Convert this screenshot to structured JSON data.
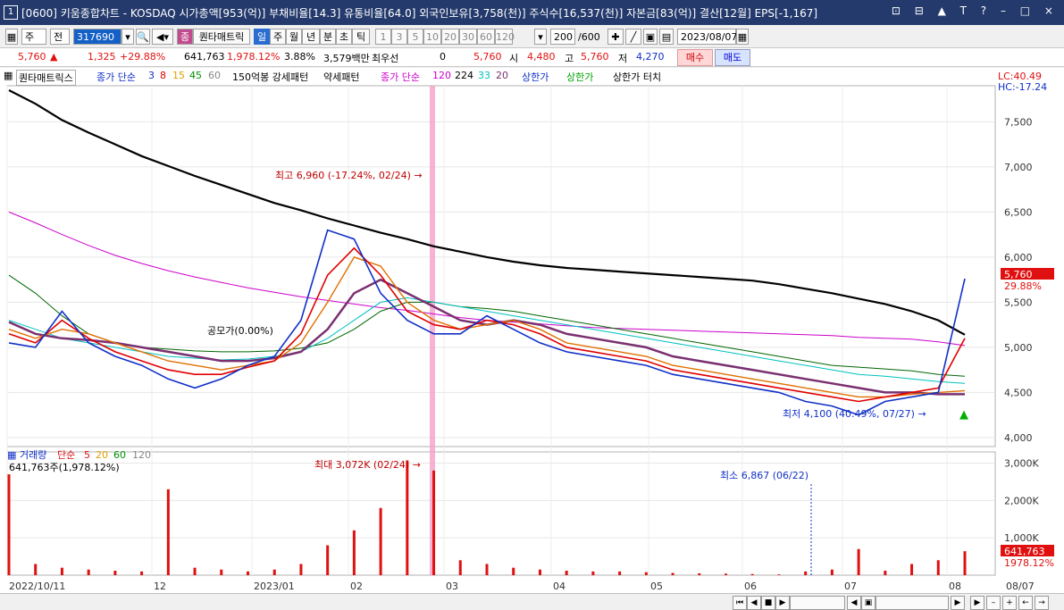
{
  "title": {
    "text": "[0600] 키움종합차트 - KOSDAQ 시가총액[953(억)] 부채비율[14.3] 유통비율[64.0] 외국인보유[3,758(천)] 주식수[16,537(천)] 자본금[83(억)] 결산[12월] EPS[-1,167]",
    "num": "1",
    "buttons": "⊡ ⊟ ▲ T ?   –  □  ×"
  },
  "toolbar": {
    "market": "주",
    "mode": "전",
    "code": "317690",
    "quantamatrix": "퀀타매트릭",
    "jong": "종",
    "periods": [
      "일",
      "주",
      "월",
      "년",
      "분",
      "초",
      "틱"
    ],
    "period_selected": "일",
    "numbers": [
      "1",
      "3",
      "5",
      "10",
      "20",
      "30",
      "60",
      "120"
    ],
    "count": "200",
    "count_total": "/600",
    "date": "2023/08/07"
  },
  "pricebar": {
    "price": "5,760",
    "change": "1,325",
    "change_pct": "+29.88%",
    "volume": "641,763",
    "volume_pct": "1,978.12%",
    "turnover": "3.88%",
    "amount": "3,579백만",
    "pref_label": "최우선",
    "pref_value": "0",
    "open_price": "5,760",
    "open_label": "시",
    "open": "4,480",
    "high_label": "고",
    "high": "5,760",
    "low_label": "저",
    "low": "4,270",
    "buy": "매수",
    "sell": "매도"
  },
  "legend": {
    "name": "퀀타매트릭스",
    "ma_label": "종가 단순",
    "ma3": "3",
    "ma8": "8",
    "ma15": "15",
    "ma45": "45",
    "ma60": "60",
    "item150": "150억봉 강세패턴",
    "weak": "약세패턴",
    "ma_label2": "종가 단순",
    "ma120": "120",
    "ma224": "224",
    "ma33": "33",
    "ma20": "20",
    "upper": "상한가",
    "upper2": "상한가",
    "upper_touch": "상한가 터치"
  },
  "vol_legend": {
    "label": "거래량",
    "simple": "단순",
    "v5": "5",
    "v20": "20",
    "v60": "60",
    "v120": "120",
    "value": "641,763주(1,978.12%)"
  },
  "annotations": {
    "lc": "LC:40.49",
    "hc": "HC:-17.24",
    "high_mark": "최고 6,960 (-17.24%, 02/24)",
    "low_mark": "최저 4,100 (40.49%, 07/27)",
    "vol_max": "최대 3,072K (02/24)",
    "vol_min": "최소 6,867 (06/22)",
    "small_label": "공모가(0.00%)",
    "last_price": "5,760",
    "last_pct": "29.88%",
    "last_vol": "641,763",
    "last_vol_pct": "1978.12%"
  },
  "colors": {
    "up": "#e01010",
    "down": "#1030c8",
    "ma224": "#000000",
    "pink_band": "#f4a0c8"
  },
  "chart_data": {
    "type": "line",
    "price_axis": {
      "ticks": [
        "7,500",
        "7,000",
        "6,500",
        "6,000",
        "5,500",
        "5,000",
        "4,500",
        "4,000"
      ],
      "ylim": [
        3900,
        7900
      ]
    },
    "volume_axis": {
      "ticks": [
        "3,000K",
        "2,000K",
        "1,000K"
      ],
      "ylim": [
        0,
        3300
      ]
    },
    "x_labels": [
      "2022/10/11",
      "12",
      "2023/01",
      "02",
      "03",
      "04",
      "05",
      "06",
      "07",
      "08",
      "08/07"
    ],
    "series": [
      {
        "name": "224",
        "color": "#000000",
        "values": [
          7850,
          7700,
          7520,
          7380,
          7250,
          7120,
          7010,
          6900,
          6800,
          6700,
          6600,
          6520,
          6430,
          6350,
          6270,
          6200,
          6120,
          6060,
          6000,
          5950,
          5910,
          5880,
          5860,
          5840,
          5820,
          5800,
          5780,
          5760,
          5740,
          5700,
          5650,
          5600,
          5540,
          5480,
          5400,
          5300,
          5140
        ]
      },
      {
        "name": "120",
        "color": "#cc00cc",
        "values": [
          6500,
          6380,
          6250,
          6130,
          6020,
          5930,
          5850,
          5780,
          5720,
          5660,
          5610,
          5560,
          5520,
          5480,
          5440,
          5410,
          5370,
          5330,
          5300,
          5280,
          5260,
          5240,
          5220,
          5210,
          5200,
          5190,
          5180,
          5170,
          5160,
          5150,
          5140,
          5130,
          5110,
          5100,
          5090,
          5060,
          5020
        ]
      },
      {
        "name": "60",
        "color": "#006600",
        "values": [
          5800,
          5600,
          5350,
          5150,
          5050,
          5000,
          4980,
          4960,
          4950,
          4950,
          4960,
          4990,
          5050,
          5200,
          5400,
          5500,
          5500,
          5450,
          5430,
          5400,
          5350,
          5300,
          5250,
          5200,
          5150,
          5100,
          5050,
          5000,
          4950,
          4900,
          4850,
          4800,
          4780,
          4760,
          4740,
          4700,
          4680
        ]
      },
      {
        "name": "33",
        "color": "#00c0c0",
        "values": [
          5300,
          5200,
          5100,
          5050,
          5000,
          4950,
          4900,
          4880,
          4860,
          4870,
          4900,
          4950,
          5100,
          5300,
          5500,
          5550,
          5500,
          5450,
          5400,
          5350,
          5300,
          5250,
          5200,
          5150,
          5100,
          5050,
          5000,
          4950,
          4900,
          4850,
          4800,
          4750,
          4700,
          4680,
          4650,
          4620,
          4600
        ]
      },
      {
        "name": "20",
        "color": "#7a3070",
        "values": [
          5280,
          5150,
          5100,
          5080,
          5050,
          5000,
          4950,
          4900,
          4850,
          4850,
          4880,
          4950,
          5200,
          5600,
          5750,
          5600,
          5450,
          5300,
          5250,
          5300,
          5250,
          5150,
          5100,
          5050,
          5000,
          4900,
          4850,
          4800,
          4750,
          4700,
          4650,
          4600,
          4550,
          4500,
          4500,
          4480,
          4480
        ]
      },
      {
        "name": "8",
        "color": "#e07000",
        "values": [
          5200,
          5100,
          5200,
          5150,
          5050,
          4950,
          4850,
          4800,
          4750,
          4800,
          4850,
          5050,
          5500,
          6000,
          5900,
          5500,
          5300,
          5200,
          5250,
          5300,
          5200,
          5050,
          5000,
          4950,
          4900,
          4800,
          4750,
          4700,
          4650,
          4600,
          4550,
          4500,
          4450,
          4450,
          4480,
          4500,
          4520
        ]
      },
      {
        "name": "3",
        "color": "#e00000",
        "values": [
          5150,
          5050,
          5300,
          5100,
          4950,
          4850,
          4750,
          4700,
          4700,
          4780,
          4850,
          5150,
          5800,
          6100,
          5800,
          5400,
          5250,
          5200,
          5300,
          5250,
          5150,
          5000,
          4950,
          4900,
          4850,
          4750,
          4700,
          4650,
          4600,
          4550,
          4500,
          4450,
          4400,
          4450,
          4500,
          4550,
          5100
        ]
      },
      {
        "name": "close",
        "color": "#1030c8",
        "values": [
          5050,
          5000,
          5400,
          5050,
          4900,
          4800,
          4650,
          4550,
          4650,
          4800,
          4900,
          5300,
          6300,
          6200,
          5600,
          5300,
          5150,
          5150,
          5350,
          5200,
          5050,
          4950,
          4900,
          4850,
          4800,
          4700,
          4650,
          4600,
          4550,
          4500,
          4400,
          4350,
          4250,
          4400,
          4450,
          4500,
          5760
        ]
      }
    ],
    "volume": [
      2700,
      300,
      200,
      150,
      120,
      100,
      2300,
      200,
      150,
      100,
      150,
      300,
      800,
      1200,
      1800,
      3072,
      2800,
      400,
      300,
      200,
      150,
      120,
      100,
      100,
      80,
      60,
      50,
      40,
      30,
      20,
      100,
      150,
      700,
      120,
      300,
      400,
      642
    ]
  }
}
